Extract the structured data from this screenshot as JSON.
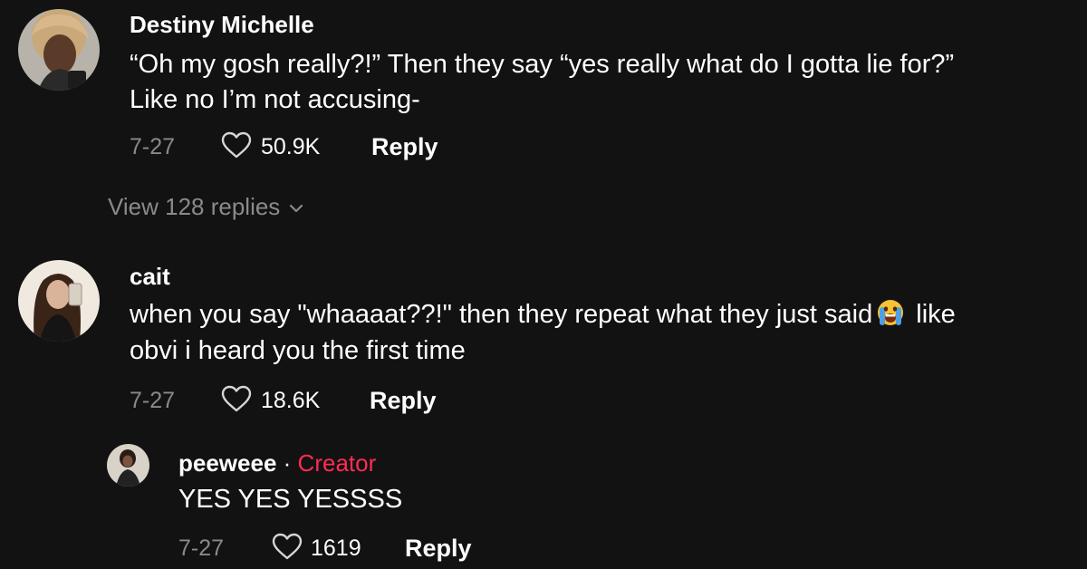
{
  "comments": [
    {
      "username": "Destiny Michelle",
      "line1": "“Oh my gosh really?!” Then they say “yes really what do I gotta lie for?”",
      "line2": "Like no I’m not accusing-",
      "date": "7-27",
      "likes": "50.9K",
      "reply_label": "Reply",
      "view_replies": "View 128 replies",
      "avatar_icon": "avatar-photo"
    },
    {
      "username": "cait",
      "line1_a": "when you say \"whaaaat??!\" then they repeat what they just said",
      "line1_b": "like",
      "emoji_icon": "crying-face-emoji",
      "line2": "obvi i heard you the first time",
      "date": "7-27",
      "likes": "18.6K",
      "reply_label": "Reply",
      "avatar_icon": "avatar-photo"
    }
  ],
  "reply": {
    "username": "peeweee",
    "separator": "·",
    "creator_label": "Creator",
    "text": "YES YES YESSSS",
    "date": "7-27",
    "likes": "1619",
    "reply_label": "Reply",
    "avatar_icon": "avatar-photo"
  },
  "colors": {
    "background": "#121212",
    "muted_text": "#8a8a8a",
    "creator_accent": "#fe2c55"
  }
}
